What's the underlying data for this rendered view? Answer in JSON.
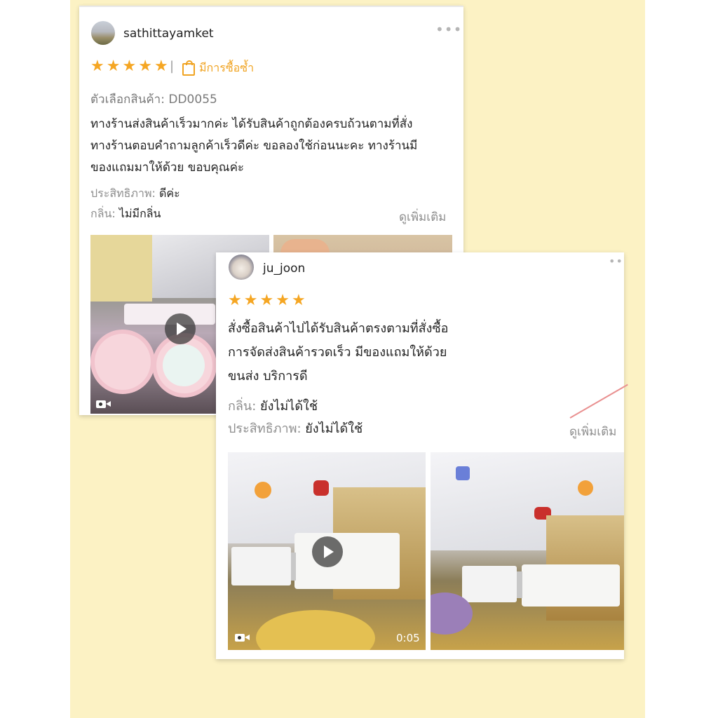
{
  "reviews": [
    {
      "username": "sathittayamket",
      "rating": 5,
      "repeat_label": "มีการซื้อซ้ำ",
      "variant_label": "ตัวเลือกสินค้า:",
      "variant_value": "DD0055",
      "text_lines": [
        "ทางร้านส่งสินค้าเร็วมากค่ะ ได้รับสินค้าถูกต้องครบถ้วนตามที่สั่ง",
        "ทางร้านตอบคำถามลูกค้าเร็วดีค่ะ ขอลองใช้ก่อนนะคะ ทางร้านมี",
        "ของแถมมาให้ด้วย ขอบคุณค่ะ"
      ],
      "attr1_label": "ประสิทธิภาพ:",
      "attr1_value": "ดีค่ะ",
      "attr2_label": "กลิ่น:",
      "attr2_value": "ไม่มีกลิ่น",
      "see_more": "ดูเพิ่มเติม"
    },
    {
      "username": "ju_joon",
      "rating": 5,
      "text_lines": [
        "สั่งซื้อสินค้าไปได้รับสินค้าตรงตามที่สั่งซื้อ",
        "การจัดส่งสินค้ารวดเร็ว มีของแถมให้ด้วย",
        "ขนส่ง บริการดี"
      ],
      "attr1_label": "กลิ่น:",
      "attr1_value": "ยังไม่ได้ใช้",
      "attr2_label": "ประสิทธิภาพ:",
      "attr2_value": "ยังไม่ได้ใช้",
      "see_more": "ดูเพิ่มเติม",
      "video_duration": "0:05"
    }
  ],
  "icons": {
    "star": "star-icon",
    "more": "more-options-icon",
    "bag": "shopping-bag-icon",
    "play": "play-icon",
    "video": "video-camera-icon"
  },
  "colors": {
    "background": "#fcf2c4",
    "star": "#f5a623",
    "repeat": "#f0a321",
    "muted": "#8e8e8e"
  }
}
